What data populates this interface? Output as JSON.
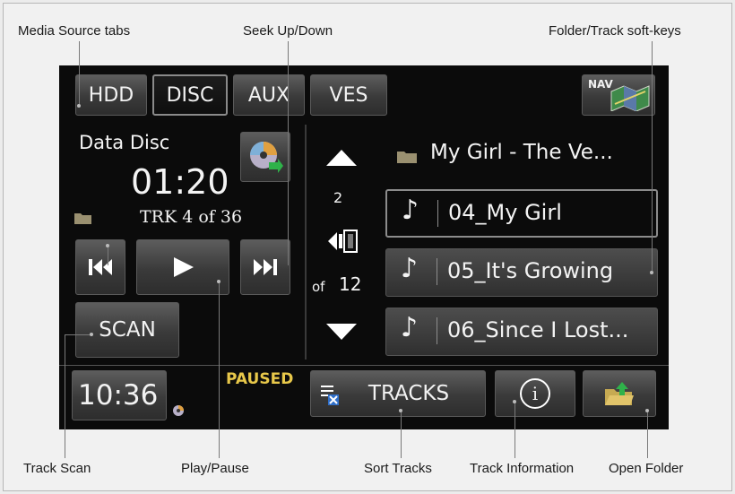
{
  "callouts": {
    "media_source_tabs": "Media Source tabs",
    "seek_up_down": "Seek Up/Down",
    "folder_track_soft_keys": "Folder/Track soft-keys",
    "track_scan": "Track Scan",
    "play_pause": "Play/Pause",
    "sort_tracks": "Sort Tracks",
    "track_information": "Track Information",
    "open_folder": "Open Folder"
  },
  "source_tabs": [
    "HDD",
    "DISC",
    "AUX",
    "VES"
  ],
  "active_source": "DISC",
  "nav_label": "NAV",
  "now_playing": {
    "source_title": "Data Disc",
    "elapsed": "01:20",
    "track_counter": "TRK 4 of 36"
  },
  "folder_nav": {
    "folder_number": "2",
    "of_label": "of",
    "folder_total": "12"
  },
  "folder_name": "My Girl - The Ve...",
  "tracks": [
    {
      "name": "04_My Girl",
      "selected": true
    },
    {
      "name": "05_It's Growing",
      "selected": false
    },
    {
      "name": "06_Since I Lost...",
      "selected": false
    }
  ],
  "controls": {
    "scan_label": "SCAN",
    "clock": "10:36",
    "status": "PAUSED",
    "tracks_label": "TRACKS",
    "info_glyph": "i"
  },
  "icons": {
    "prev": "skip-back-icon",
    "play": "play-icon",
    "next": "skip-forward-icon",
    "up": "arrow-up-icon",
    "down": "arrow-down-icon",
    "folder": "folder-icon",
    "disc": "disc-icon",
    "note": "music-note-icon",
    "sort": "sort-list-icon",
    "info": "info-icon",
    "open_folder": "open-folder-icon",
    "nav": "map-icon"
  },
  "colors": {
    "screen_bg": "#0b0b0b",
    "status_yellow": "#e8c84a",
    "button_gray": "#4a4a4a"
  }
}
